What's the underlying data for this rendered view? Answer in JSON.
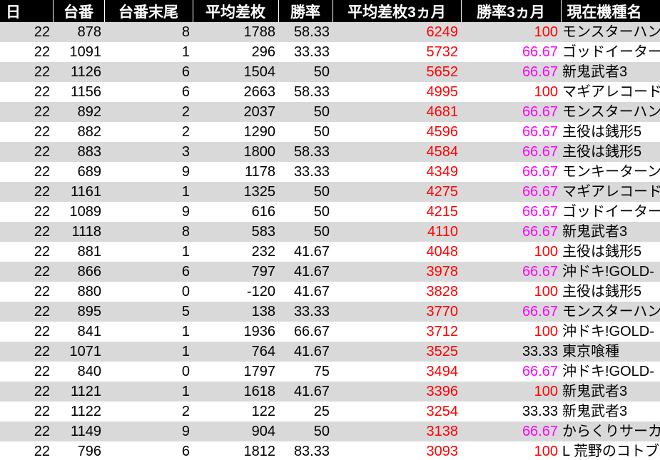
{
  "colors": {
    "header_bg": "#000000",
    "header_text": "#ffffff",
    "stripe": "#d9d9d9",
    "red": "#ff0000",
    "magenta": "#ff00ff"
  },
  "headers": [
    "日",
    "台番",
    "台番末尾",
    "平均差枚",
    "勝率",
    "平均差枚3ヵ月",
    "勝率3ヵ月",
    "現在機種名"
  ],
  "rows": [
    {
      "day": "22",
      "machine_no": "878",
      "last_digit": "8",
      "avg_diff": "1788",
      "win_rate": "58.33",
      "avg_diff_3m": "6249",
      "win_rate_3m": "100",
      "model": "モンスターハン",
      "win_color": "red"
    },
    {
      "day": "22",
      "machine_no": "1091",
      "last_digit": "1",
      "avg_diff": "296",
      "win_rate": "33.33",
      "avg_diff_3m": "5732",
      "win_rate_3m": "66.67",
      "model": "ゴッドイーター",
      "win_color": "magenta"
    },
    {
      "day": "22",
      "machine_no": "1126",
      "last_digit": "6",
      "avg_diff": "1504",
      "win_rate": "50",
      "avg_diff_3m": "5652",
      "win_rate_3m": "66.67",
      "model": "新鬼武者3",
      "win_color": "magenta"
    },
    {
      "day": "22",
      "machine_no": "1156",
      "last_digit": "6",
      "avg_diff": "2663",
      "win_rate": "58.33",
      "avg_diff_3m": "4995",
      "win_rate_3m": "100",
      "model": "マギアレコード",
      "win_color": "red"
    },
    {
      "day": "22",
      "machine_no": "892",
      "last_digit": "2",
      "avg_diff": "2037",
      "win_rate": "50",
      "avg_diff_3m": "4681",
      "win_rate_3m": "66.67",
      "model": "モンスターハン",
      "win_color": "magenta"
    },
    {
      "day": "22",
      "machine_no": "882",
      "last_digit": "2",
      "avg_diff": "1290",
      "win_rate": "50",
      "avg_diff_3m": "4596",
      "win_rate_3m": "66.67",
      "model": "主役は銭形5",
      "win_color": "magenta"
    },
    {
      "day": "22",
      "machine_no": "883",
      "last_digit": "3",
      "avg_diff": "1800",
      "win_rate": "58.33",
      "avg_diff_3m": "4584",
      "win_rate_3m": "66.67",
      "model": "主役は銭形5",
      "win_color": "magenta"
    },
    {
      "day": "22",
      "machine_no": "689",
      "last_digit": "9",
      "avg_diff": "1178",
      "win_rate": "33.33",
      "avg_diff_3m": "4349",
      "win_rate_3m": "66.67",
      "model": "モンキーターン",
      "win_color": "magenta"
    },
    {
      "day": "22",
      "machine_no": "1161",
      "last_digit": "1",
      "avg_diff": "1325",
      "win_rate": "50",
      "avg_diff_3m": "4275",
      "win_rate_3m": "66.67",
      "model": "マギアレコード",
      "win_color": "magenta"
    },
    {
      "day": "22",
      "machine_no": "1089",
      "last_digit": "9",
      "avg_diff": "616",
      "win_rate": "50",
      "avg_diff_3m": "4215",
      "win_rate_3m": "66.67",
      "model": "ゴッドイーター",
      "win_color": "magenta"
    },
    {
      "day": "22",
      "machine_no": "1118",
      "last_digit": "8",
      "avg_diff": "583",
      "win_rate": "50",
      "avg_diff_3m": "4110",
      "win_rate_3m": "66.67",
      "model": "新鬼武者3",
      "win_color": "magenta"
    },
    {
      "day": "22",
      "machine_no": "881",
      "last_digit": "1",
      "avg_diff": "232",
      "win_rate": "41.67",
      "avg_diff_3m": "4048",
      "win_rate_3m": "100",
      "model": "主役は銭形5",
      "win_color": "red"
    },
    {
      "day": "22",
      "machine_no": "866",
      "last_digit": "6",
      "avg_diff": "797",
      "win_rate": "41.67",
      "avg_diff_3m": "3978",
      "win_rate_3m": "66.67",
      "model": "沖ドキ!GOLD-",
      "win_color": "magenta"
    },
    {
      "day": "22",
      "machine_no": "880",
      "last_digit": "0",
      "avg_diff": "-120",
      "win_rate": "41.67",
      "avg_diff_3m": "3828",
      "win_rate_3m": "100",
      "model": "主役は銭形5",
      "win_color": "red"
    },
    {
      "day": "22",
      "machine_no": "895",
      "last_digit": "5",
      "avg_diff": "138",
      "win_rate": "33.33",
      "avg_diff_3m": "3770",
      "win_rate_3m": "66.67",
      "model": "モンスターハン",
      "win_color": "magenta"
    },
    {
      "day": "22",
      "machine_no": "841",
      "last_digit": "1",
      "avg_diff": "1936",
      "win_rate": "66.67",
      "avg_diff_3m": "3712",
      "win_rate_3m": "100",
      "model": "沖ドキ!GOLD-",
      "win_color": "red"
    },
    {
      "day": "22",
      "machine_no": "1071",
      "last_digit": "1",
      "avg_diff": "764",
      "win_rate": "41.67",
      "avg_diff_3m": "3525",
      "win_rate_3m": "33.33",
      "model": "東京喰種",
      "win_color": "black"
    },
    {
      "day": "22",
      "machine_no": "840",
      "last_digit": "0",
      "avg_diff": "1797",
      "win_rate": "75",
      "avg_diff_3m": "3494",
      "win_rate_3m": "66.67",
      "model": "沖ドキ!GOLD-",
      "win_color": "magenta"
    },
    {
      "day": "22",
      "machine_no": "1121",
      "last_digit": "1",
      "avg_diff": "1618",
      "win_rate": "41.67",
      "avg_diff_3m": "3396",
      "win_rate_3m": "100",
      "model": "新鬼武者3",
      "win_color": "red"
    },
    {
      "day": "22",
      "machine_no": "1122",
      "last_digit": "2",
      "avg_diff": "122",
      "win_rate": "25",
      "avg_diff_3m": "3254",
      "win_rate_3m": "33.33",
      "model": "新鬼武者3",
      "win_color": "black"
    },
    {
      "day": "22",
      "machine_no": "1149",
      "last_digit": "9",
      "avg_diff": "904",
      "win_rate": "50",
      "avg_diff_3m": "3138",
      "win_rate_3m": "66.67",
      "model": "からくりサーカ",
      "win_color": "magenta"
    },
    {
      "day": "22",
      "machine_no": "796",
      "last_digit": "6",
      "avg_diff": "1812",
      "win_rate": "83.33",
      "avg_diff_3m": "3093",
      "win_rate_3m": "100",
      "model": "L 荒野のコトブ",
      "win_color": "red"
    }
  ]
}
